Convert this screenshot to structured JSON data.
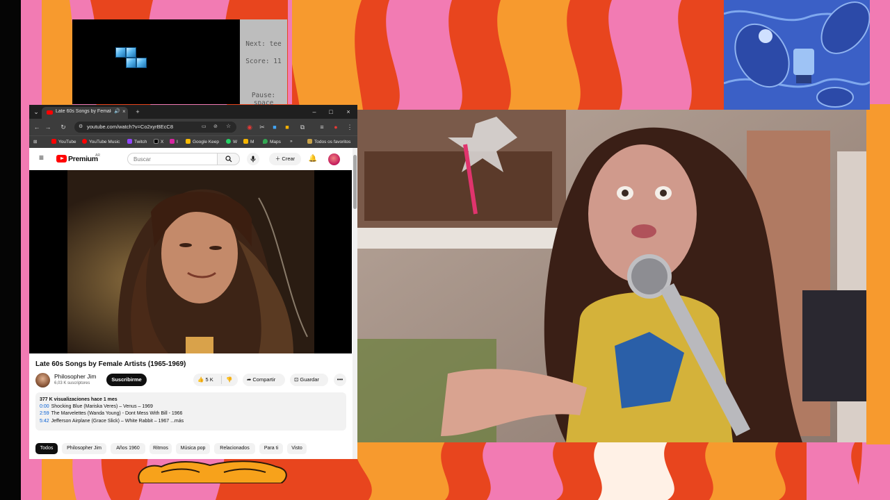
{
  "tetris": {
    "next_label": "Next: tee",
    "score_label": "Score: 11",
    "pause_label": "Pause: space"
  },
  "browser": {
    "tab_title": "Late 60s Songs by Female A",
    "url": "youtube.com/watch?v=Co2xyrBEcC8",
    "bookmarks": [
      "YouTube",
      "YouTube Music",
      "Twitch",
      "X",
      "I",
      "Google Keep",
      "W",
      "M",
      "Maps"
    ],
    "all_bookmarks_label": "Todos os favoritos"
  },
  "youtube": {
    "logo_text": "Premium",
    "logo_country": "AR",
    "search_placeholder": "Buscar",
    "create_label": "Crear",
    "video_title": "Late 60s Songs by Female Artists (1965-1969)",
    "channel_name": "Philosopher Jim",
    "channel_subs": "6,03 K suscriptores",
    "subscribe_label": "Suscribirme",
    "like_count": "5 K",
    "share_label": "Compartir",
    "save_label": "Guardar",
    "description": {
      "stats": "377 K visualizaciones  hace 1 mes",
      "lines": [
        {
          "time": "0:00",
          "text": "Shocking Blue (Mariska Veres) – Venus – 1969"
        },
        {
          "time": "2:59",
          "text": "The Marvelettes (Wanda Young) - Dont Mess With Bill - 1966"
        },
        {
          "time": "5:42",
          "text": "Jefferson Airplane (Grace Slick) – White Rabbit – 1967 ...más"
        }
      ]
    },
    "chips": [
      "Todos",
      "Philosopher Jim",
      "Años 1960",
      "Ritmos",
      "Música pop",
      "Relacionados",
      "Para ti",
      "Visto"
    ]
  },
  "colors": {
    "backdrop_red": "#e8451e",
    "backdrop_pink": "#f27bb3",
    "backdrop_orange": "#f79a2e",
    "youtube_red": "#ff0000",
    "chrome_dark": "#3c3c3c"
  }
}
